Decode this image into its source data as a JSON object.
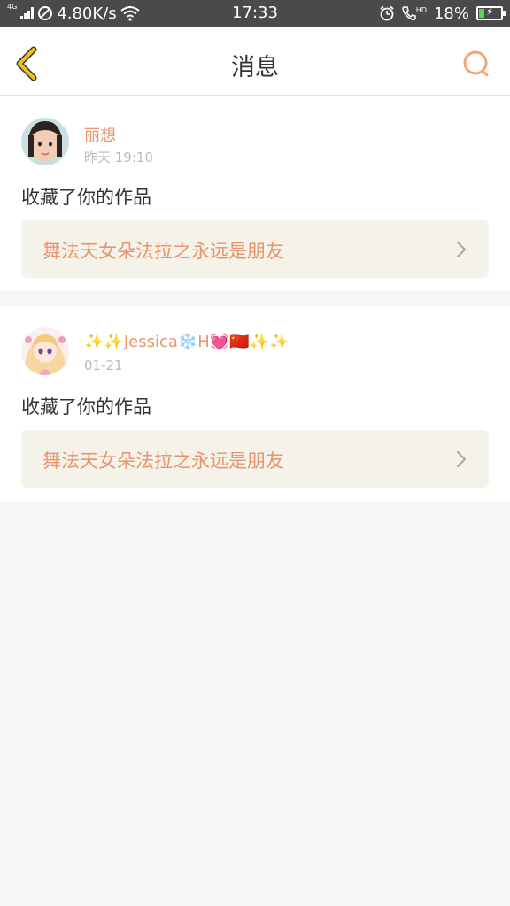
{
  "status_bar": {
    "network": "4G",
    "speed": "4.80K/s",
    "time": "17:33",
    "battery": "18%",
    "hd": "HD"
  },
  "nav": {
    "title": "消息",
    "back_icon": "chevron-left-icon",
    "search_icon": "search-icon",
    "accent_color": "#f0c020"
  },
  "messages": [
    {
      "username": "丽想",
      "time": "昨天 19:10",
      "action": "收藏了你的作品",
      "work_title": "舞法天女朵法拉之永远是朋友"
    },
    {
      "username": "✨✨Jessica❄️H💓🇨🇳✨✨",
      "time": "01-21",
      "action": "收藏了你的作品",
      "work_title": "舞法天女朵法拉之永远是朋友"
    }
  ],
  "colors": {
    "accent_orange": "#e8956b",
    "work_bg": "#f4f2e9",
    "status_bg": "#4a4a4a"
  }
}
